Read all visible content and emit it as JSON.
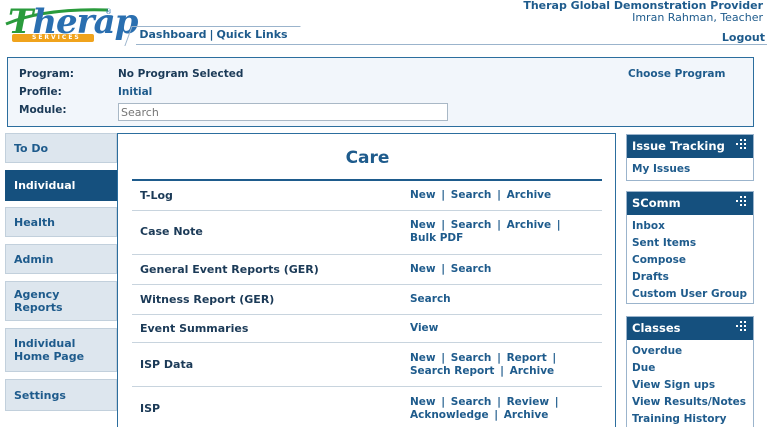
{
  "header": {
    "logo_text": "Therap",
    "logo_subtext": "SERVICES",
    "nav": [
      "Dashboard",
      "Quick Links"
    ],
    "provider": "Therap Global Demonstration Provider",
    "user": "Imran Rahman, Teacher",
    "logout": "Logout"
  },
  "program": {
    "program_label": "Program:",
    "program_value": "No Program Selected",
    "profile_label": "Profile:",
    "profile_value": "Initial",
    "module_label": "Module:",
    "module_placeholder": "Search",
    "choose_program": "Choose Program"
  },
  "leftnav": {
    "items": [
      {
        "label": "To Do",
        "active": false
      },
      {
        "label": "Individual",
        "active": true
      },
      {
        "label": "Health",
        "active": false
      },
      {
        "label": "Admin",
        "active": false
      },
      {
        "label": "Agency Reports",
        "active": false
      },
      {
        "label": "Individual Home Page",
        "active": false
      },
      {
        "label": "Settings",
        "active": false
      }
    ]
  },
  "care": {
    "title": "Care",
    "rows": [
      {
        "name": "T-Log",
        "actions": [
          "New",
          "Search",
          "Archive"
        ]
      },
      {
        "name": "Case Note",
        "actions": [
          "New",
          "Search",
          "Archive",
          "Bulk PDF"
        ]
      },
      {
        "name": "General Event Reports (GER)",
        "actions": [
          "New",
          "Search"
        ]
      },
      {
        "name": "Witness Report (GER)",
        "actions": [
          "Search"
        ]
      },
      {
        "name": "Event Summaries",
        "actions": [
          "View"
        ]
      },
      {
        "name": "ISP Data",
        "actions": [
          "New",
          "Search",
          "Report",
          "Search Report",
          "Archive"
        ]
      },
      {
        "name": "ISP",
        "actions": [
          "New",
          "Search",
          "Review",
          "Acknowledge",
          "Archive"
        ]
      }
    ]
  },
  "widgets": [
    {
      "title": "Issue Tracking",
      "links": [
        "My Issues"
      ]
    },
    {
      "title": "SComm",
      "links": [
        "Inbox",
        "Sent Items",
        "Compose",
        "Drafts",
        "Custom User Group"
      ]
    },
    {
      "title": "Classes",
      "links": [
        "Overdue",
        "Due",
        "View Sign ups",
        "View Results/Notes",
        "Training History"
      ]
    }
  ],
  "colors": {
    "brand_dark": "#15507e",
    "link": "#1e5b8c",
    "border": "#2c6e9e",
    "logo_green": "#2a9b3c",
    "logo_orange": "#f0a31c"
  }
}
